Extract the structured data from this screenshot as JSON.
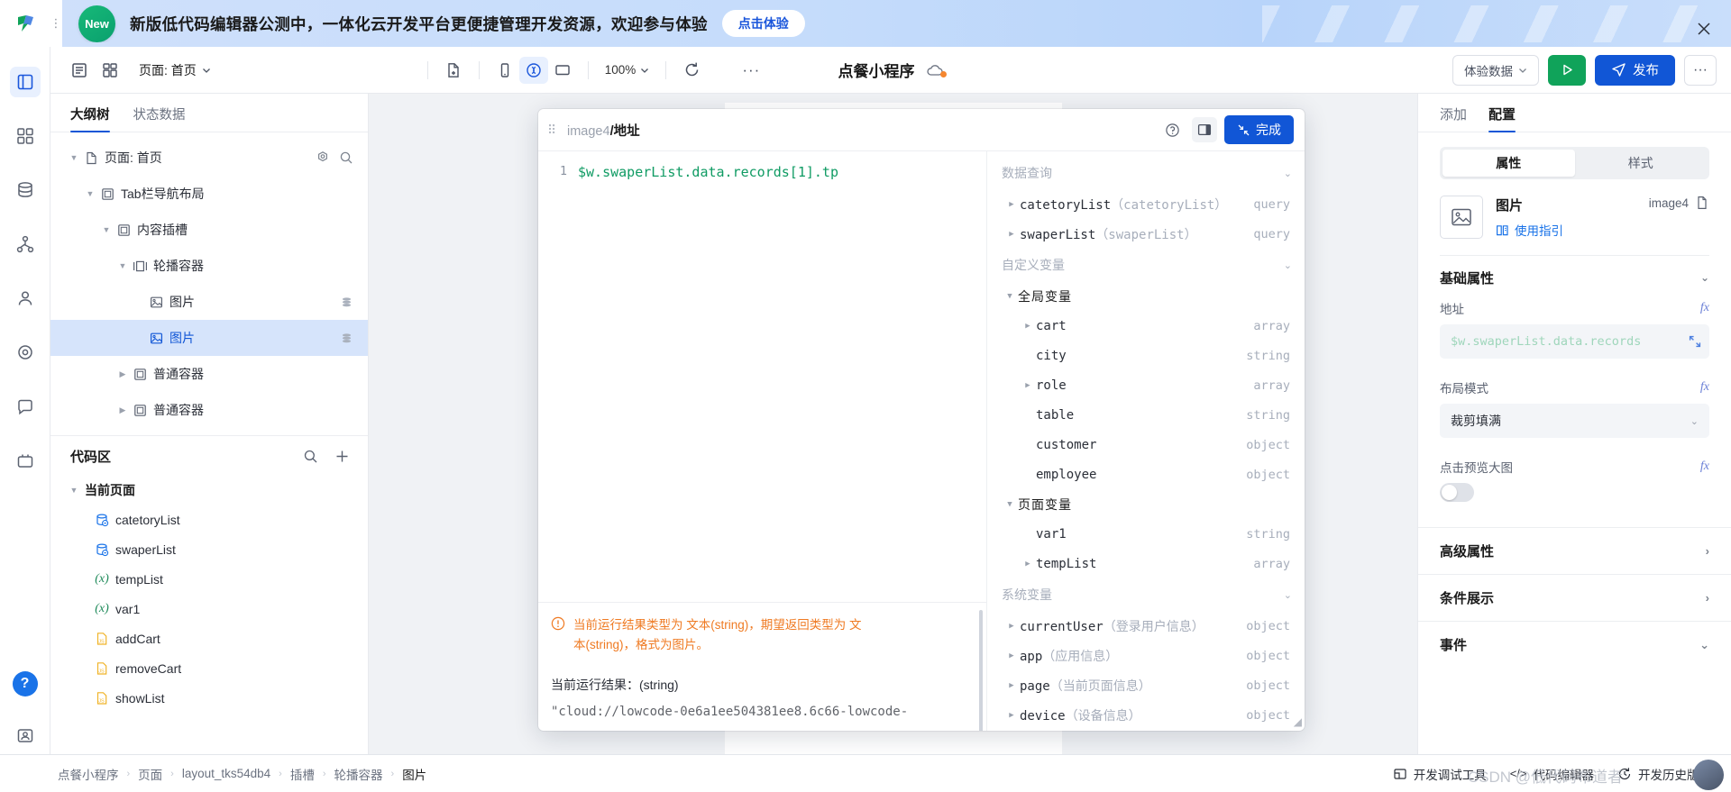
{
  "promo": {
    "badge": "New",
    "text": "新版低代码编辑器公测中，一体化云开发平台更便捷管理开发资源，欢迎参与体验",
    "cta": "点击体验",
    "close_icon": "close-icon"
  },
  "toolbar": {
    "page_label": "页面: 首页",
    "zoom": "100%",
    "title": "点餐小程序",
    "experience_data": "体验数据",
    "publish": "发布",
    "more": "···",
    "icons": [
      "outline-icon",
      "grid-icon",
      "new-page-icon",
      "mobile-icon",
      "wechat-icon",
      "desktop-icon",
      "refresh-icon",
      "more-icon"
    ]
  },
  "left_panel": {
    "tabs": [
      {
        "label": "大纲树",
        "active": true
      },
      {
        "label": "状态数据",
        "active": false
      }
    ],
    "tree": [
      {
        "label": "页面: 首页",
        "indent": 0,
        "icon": "page-icon",
        "caret": "down",
        "actions": [
          "gear-icon",
          "search-icon"
        ]
      },
      {
        "label": "Tab栏导航布局",
        "indent": 1,
        "icon": "container-icon",
        "caret": "down"
      },
      {
        "label": "内容插槽",
        "indent": 2,
        "icon": "container-icon",
        "caret": "down"
      },
      {
        "label": "轮播容器",
        "indent": 3,
        "icon": "swiper-icon",
        "caret": "down"
      },
      {
        "label": "图片",
        "indent": 4,
        "icon": "image-icon",
        "badge": "data-icon"
      },
      {
        "label": "图片",
        "indent": 4,
        "icon": "image-icon",
        "badge": "data-icon",
        "selected": true
      },
      {
        "label": "普通容器",
        "indent": 3,
        "icon": "container-icon",
        "caret": "right"
      },
      {
        "label": "普通容器",
        "indent": 3,
        "icon": "container-icon",
        "caret": "right"
      }
    ],
    "code_area": {
      "title": "代码区",
      "actions": [
        "search-icon",
        "plus-icon"
      ],
      "group": "当前页面",
      "items": [
        {
          "label": "catetoryList",
          "type": "query"
        },
        {
          "label": "swaperList",
          "type": "query"
        },
        {
          "label": "tempList",
          "type": "var"
        },
        {
          "label": "var1",
          "type": "var"
        },
        {
          "label": "addCart",
          "type": "js"
        },
        {
          "label": "removeCart",
          "type": "js"
        },
        {
          "label": "showList",
          "type": "js"
        }
      ]
    }
  },
  "expression_editor": {
    "path_prefix": "image4",
    "path_sep": "/",
    "path_field": "地址",
    "help_icon": "question-icon",
    "panel_icon": "panel-toggle-icon",
    "done_label": "完成",
    "line_number": "1",
    "code": "$w.swaperList.data.records[1].tp",
    "warning": "当前运行结果类型为 文本(string)，期望返回类型为 文本(string)，格式为图片。",
    "result_label": "当前运行结果：(string)",
    "result_value": "\"cloud://lowcode-0e6a1ee504381ee8.6c66-lowcode-",
    "variables": {
      "sections": [
        {
          "title": "数据查询",
          "collapsible": true,
          "rows": [
            {
              "name": "catetoryList",
              "alias": "（catetoryList）",
              "type": "query",
              "caret": "right",
              "indent": 0
            },
            {
              "name": "swaperList",
              "alias": "（swaperList）",
              "type": "query",
              "caret": "right",
              "indent": 0
            }
          ]
        },
        {
          "title": "自定义变量",
          "collapsible": true,
          "rows": [
            {
              "name": "全局变量",
              "type": "",
              "caret": "down",
              "indent": 0,
              "group": true
            },
            {
              "name": "cart",
              "type": "array",
              "caret": "right",
              "indent": 1
            },
            {
              "name": "city",
              "type": "string",
              "caret": "",
              "indent": 1
            },
            {
              "name": "role",
              "type": "array",
              "caret": "right",
              "indent": 1
            },
            {
              "name": "table",
              "type": "string",
              "caret": "",
              "indent": 1
            },
            {
              "name": "customer",
              "type": "object",
              "caret": "",
              "indent": 1
            },
            {
              "name": "employee",
              "type": "object",
              "caret": "",
              "indent": 1
            },
            {
              "name": "页面变量",
              "type": "",
              "caret": "down",
              "indent": 0,
              "group": true
            },
            {
              "name": "var1",
              "type": "string",
              "caret": "",
              "indent": 1
            },
            {
              "name": "tempList",
              "type": "array",
              "caret": "right",
              "indent": 1
            }
          ]
        },
        {
          "title": "系统变量",
          "collapsible": true,
          "rows": [
            {
              "name": "currentUser",
              "alias": "（登录用户信息）",
              "type": "object",
              "caret": "right",
              "indent": 0
            },
            {
              "name": "app",
              "alias": "（应用信息）",
              "type": "object",
              "caret": "right",
              "indent": 0
            },
            {
              "name": "page",
              "alias": "（当前页面信息）",
              "type": "object",
              "caret": "right",
              "indent": 0
            },
            {
              "name": "device",
              "alias": "（设备信息）",
              "type": "object",
              "caret": "right",
              "indent": 0
            }
          ]
        }
      ]
    }
  },
  "right_panel": {
    "tabs": [
      {
        "label": "添加",
        "active": false
      },
      {
        "label": "配置",
        "active": true
      }
    ],
    "segments": [
      {
        "label": "属性",
        "active": true
      },
      {
        "label": "样式",
        "active": false
      }
    ],
    "component": {
      "name": "图片",
      "guide": "使用指引",
      "id": "image4",
      "copy_icon": "copy-icon",
      "thumb_icon": "image-icon",
      "guide_icon": "book-icon"
    },
    "basic_section": {
      "title": "基础属性",
      "fields": [
        {
          "label": "地址",
          "type": "input",
          "value": "$w.swaperList.data.records",
          "fx": "fx"
        },
        {
          "label": "布局模式",
          "type": "select",
          "value": "裁剪填满",
          "fx": "fx"
        },
        {
          "label": "点击预览大图",
          "type": "toggle",
          "value": "off",
          "fx": "fx"
        }
      ]
    },
    "sections": [
      {
        "title": "高级属性",
        "chev": "right"
      },
      {
        "title": "条件展示",
        "chev": "right"
      },
      {
        "title": "事件",
        "chev": "down"
      }
    ]
  },
  "status_bar": {
    "breadcrumbs": [
      "点餐小程序",
      "页面",
      "layout_tks54db4",
      "插槽",
      "轮播容器",
      "图片"
    ],
    "right_items": [
      {
        "label": "开发调试工具",
        "icon": "debug-icon"
      },
      {
        "label": "代码编辑器",
        "icon": "code-icon"
      },
      {
        "label": "开发历史版本",
        "icon": "history-icon"
      }
    ],
    "watermark": "CSDN @低代码布道者"
  },
  "colors": {
    "primary": "#1156d6",
    "success": "#10a35a",
    "warning": "#ef7a22",
    "selected_bg": "#d6e4fb"
  }
}
